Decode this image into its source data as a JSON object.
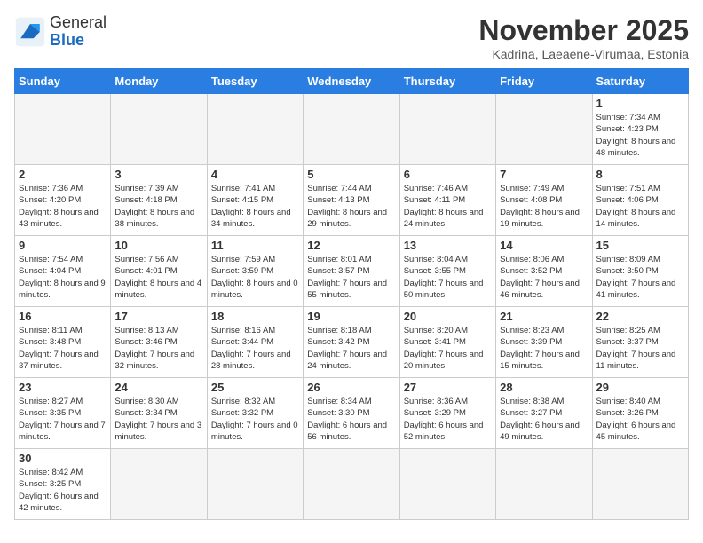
{
  "logo": {
    "line1": "General",
    "line2": "Blue"
  },
  "title": "November 2025",
  "subtitle": "Kadrina, Laeaene-Virumaa, Estonia",
  "weekdays": [
    "Sunday",
    "Monday",
    "Tuesday",
    "Wednesday",
    "Thursday",
    "Friday",
    "Saturday"
  ],
  "weeks": [
    [
      {
        "day": "",
        "empty": true
      },
      {
        "day": "",
        "empty": true
      },
      {
        "day": "",
        "empty": true
      },
      {
        "day": "",
        "empty": true
      },
      {
        "day": "",
        "empty": true
      },
      {
        "day": "",
        "empty": true
      },
      {
        "day": "1",
        "sunrise": "7:34 AM",
        "sunset": "4:23 PM",
        "daylight": "8 hours and 48 minutes."
      }
    ],
    [
      {
        "day": "2",
        "sunrise": "7:36 AM",
        "sunset": "4:20 PM",
        "daylight": "8 hours and 43 minutes."
      },
      {
        "day": "3",
        "sunrise": "7:39 AM",
        "sunset": "4:18 PM",
        "daylight": "8 hours and 38 minutes."
      },
      {
        "day": "4",
        "sunrise": "7:41 AM",
        "sunset": "4:15 PM",
        "daylight": "8 hours and 34 minutes."
      },
      {
        "day": "5",
        "sunrise": "7:44 AM",
        "sunset": "4:13 PM",
        "daylight": "8 hours and 29 minutes."
      },
      {
        "day": "6",
        "sunrise": "7:46 AM",
        "sunset": "4:11 PM",
        "daylight": "8 hours and 24 minutes."
      },
      {
        "day": "7",
        "sunrise": "7:49 AM",
        "sunset": "4:08 PM",
        "daylight": "8 hours and 19 minutes."
      },
      {
        "day": "8",
        "sunrise": "7:51 AM",
        "sunset": "4:06 PM",
        "daylight": "8 hours and 14 minutes."
      }
    ],
    [
      {
        "day": "9",
        "sunrise": "7:54 AM",
        "sunset": "4:04 PM",
        "daylight": "8 hours and 9 minutes."
      },
      {
        "day": "10",
        "sunrise": "7:56 AM",
        "sunset": "4:01 PM",
        "daylight": "8 hours and 4 minutes."
      },
      {
        "day": "11",
        "sunrise": "7:59 AM",
        "sunset": "3:59 PM",
        "daylight": "8 hours and 0 minutes."
      },
      {
        "day": "12",
        "sunrise": "8:01 AM",
        "sunset": "3:57 PM",
        "daylight": "7 hours and 55 minutes."
      },
      {
        "day": "13",
        "sunrise": "8:04 AM",
        "sunset": "3:55 PM",
        "daylight": "7 hours and 50 minutes."
      },
      {
        "day": "14",
        "sunrise": "8:06 AM",
        "sunset": "3:52 PM",
        "daylight": "7 hours and 46 minutes."
      },
      {
        "day": "15",
        "sunrise": "8:09 AM",
        "sunset": "3:50 PM",
        "daylight": "7 hours and 41 minutes."
      }
    ],
    [
      {
        "day": "16",
        "sunrise": "8:11 AM",
        "sunset": "3:48 PM",
        "daylight": "7 hours and 37 minutes."
      },
      {
        "day": "17",
        "sunrise": "8:13 AM",
        "sunset": "3:46 PM",
        "daylight": "7 hours and 32 minutes."
      },
      {
        "day": "18",
        "sunrise": "8:16 AM",
        "sunset": "3:44 PM",
        "daylight": "7 hours and 28 minutes."
      },
      {
        "day": "19",
        "sunrise": "8:18 AM",
        "sunset": "3:42 PM",
        "daylight": "7 hours and 24 minutes."
      },
      {
        "day": "20",
        "sunrise": "8:20 AM",
        "sunset": "3:41 PM",
        "daylight": "7 hours and 20 minutes."
      },
      {
        "day": "21",
        "sunrise": "8:23 AM",
        "sunset": "3:39 PM",
        "daylight": "7 hours and 15 minutes."
      },
      {
        "day": "22",
        "sunrise": "8:25 AM",
        "sunset": "3:37 PM",
        "daylight": "7 hours and 11 minutes."
      }
    ],
    [
      {
        "day": "23",
        "sunrise": "8:27 AM",
        "sunset": "3:35 PM",
        "daylight": "7 hours and 7 minutes."
      },
      {
        "day": "24",
        "sunrise": "8:30 AM",
        "sunset": "3:34 PM",
        "daylight": "7 hours and 3 minutes."
      },
      {
        "day": "25",
        "sunrise": "8:32 AM",
        "sunset": "3:32 PM",
        "daylight": "7 hours and 0 minutes."
      },
      {
        "day": "26",
        "sunrise": "8:34 AM",
        "sunset": "3:30 PM",
        "daylight": "6 hours and 56 minutes."
      },
      {
        "day": "27",
        "sunrise": "8:36 AM",
        "sunset": "3:29 PM",
        "daylight": "6 hours and 52 minutes."
      },
      {
        "day": "28",
        "sunrise": "8:38 AM",
        "sunset": "3:27 PM",
        "daylight": "6 hours and 49 minutes."
      },
      {
        "day": "29",
        "sunrise": "8:40 AM",
        "sunset": "3:26 PM",
        "daylight": "6 hours and 45 minutes."
      }
    ],
    [
      {
        "day": "30",
        "sunrise": "8:42 AM",
        "sunset": "3:25 PM",
        "daylight": "6 hours and 42 minutes."
      },
      {
        "day": "",
        "empty": true
      },
      {
        "day": "",
        "empty": true
      },
      {
        "day": "",
        "empty": true
      },
      {
        "day": "",
        "empty": true
      },
      {
        "day": "",
        "empty": true
      },
      {
        "day": "",
        "empty": true
      }
    ]
  ]
}
